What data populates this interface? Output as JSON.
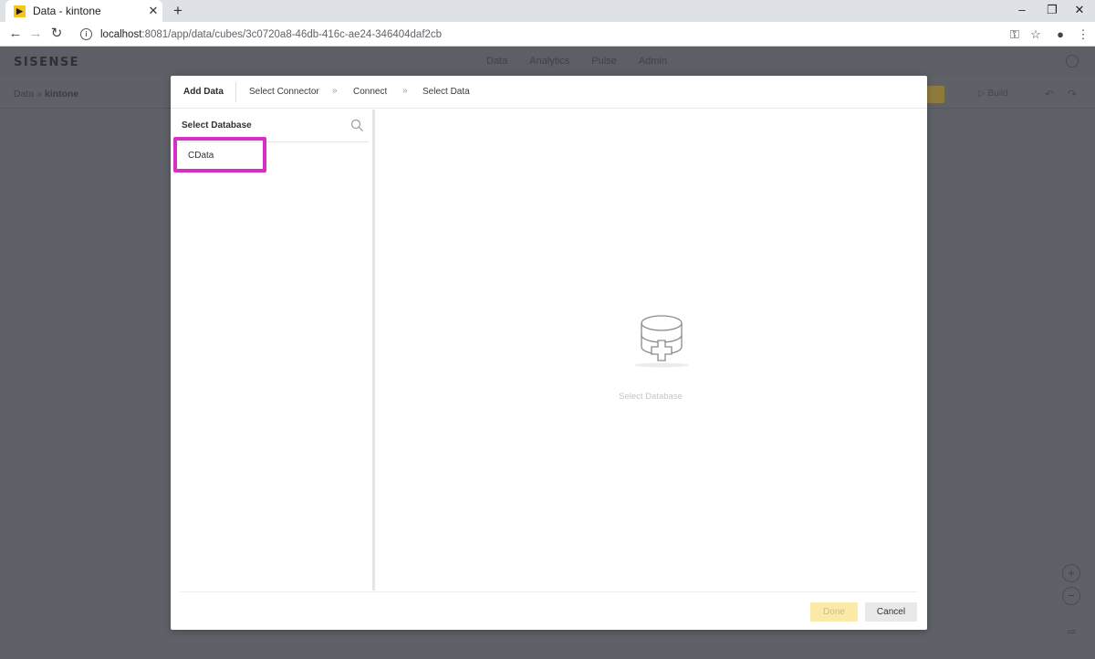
{
  "browser": {
    "tab_title": "Data - kintone",
    "tab_close": "✕",
    "new_tab": "+",
    "url_host": "localhost",
    "url_path": ":8081/app/data/cubes/3c0720a8-46db-416c-ae24-346404daf2cb",
    "window_controls": {
      "minimize": "–",
      "restore": "❐",
      "close": "✕"
    }
  },
  "app": {
    "logo": "SISENSE",
    "nav": [
      "Data",
      "Analytics",
      "Pulse",
      "Admin"
    ],
    "breadcrumb": {
      "root": "Data",
      "separator": "»",
      "current": "kintone"
    },
    "build_label": "▷ Build"
  },
  "modal": {
    "steps": {
      "add_data": "Add Data",
      "select_connector": "Select Connector",
      "connect": "Connect",
      "select_data": "Select Data",
      "separator": "»"
    },
    "left_pane": {
      "title": "Select Database",
      "items": [
        "CData"
      ]
    },
    "empty_state_label": "Select Database",
    "footer": {
      "done_label": "Done",
      "cancel_label": "Cancel"
    }
  },
  "colors": {
    "highlight": "#d62fc6",
    "done_button": "#fbe9a7",
    "overlay": "#5e6168"
  }
}
